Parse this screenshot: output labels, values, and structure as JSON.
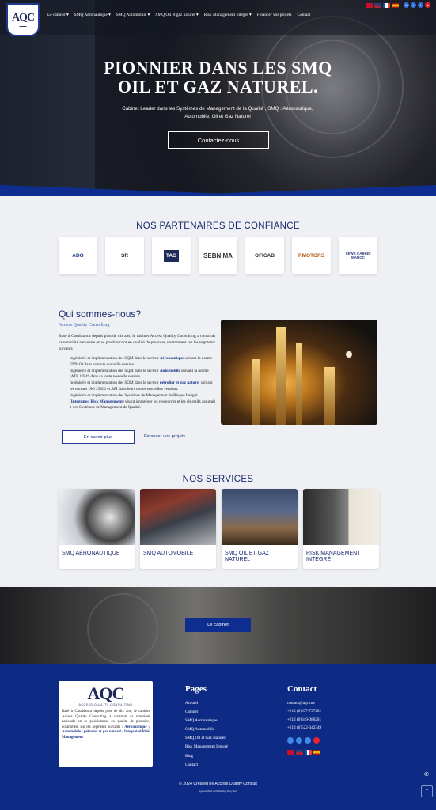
{
  "header": {
    "logo_text": "AQC",
    "nav": [
      {
        "label": "Le cabinet ▾"
      },
      {
        "label": "SMQ Aéronautique ▾"
      },
      {
        "label": "SMQ Automobile ▾"
      },
      {
        "label": "SMQ Oil et gaz naturel ▾"
      },
      {
        "label": "Risk Management Intégré ▾"
      },
      {
        "label": "Financer vos projets"
      },
      {
        "label": "Contact"
      }
    ],
    "flag_colors": [
      "#c8102e",
      "#3c3b6e",
      "#0055a4",
      "#aa151b"
    ],
    "social_icons": [
      "linkedin-icon",
      "facebook-icon",
      "twitter-icon",
      "youtube-icon"
    ]
  },
  "hero": {
    "title_line1": "PIONNIER DANS LES SMQ",
    "title_line2": "OIL ET GAZ NATUREL.",
    "subtitle": "Cabinet Leader dans les Systèmes de Management de la Qualité , SMQ : Aéronautique, Automobile, Oil et Gaz Naturel",
    "button": "Contactez-nous"
  },
  "partners": {
    "title": "NOS PARTENAIRES DE CONFIANCE",
    "logos": [
      "ADO",
      "SR",
      "TAG",
      "SEBN MA",
      "OFICAB",
      "RMOTORS",
      "SEWS CABIND MAROC"
    ]
  },
  "about": {
    "title": "Qui sommes-nous?",
    "subtitle": "Access Quality Consulting",
    "intro": "Basé à Casablanca depuis plus de dix ans, le cabinet Access Quality Consulting a construit sa notoriété nationale en se positionnant en qualité de pionnier, notamment sur les segments suivants :",
    "items": [
      {
        "pre": "Ingénierie et implémentation des SQM dans le secteur ",
        "hl": "Aéronautique",
        "post": " suivant la norme EN9100 dans sa toute nouvelle version."
      },
      {
        "pre": "Ingénierie et implémentation des SQM dans le secteur ",
        "hl": "Automobile",
        "post": " suivant la norme IATF 16949 dans sa toute nouvelle version."
      },
      {
        "pre": "Ingénierie et implémentation des SQM dans le secteur ",
        "hl": "pétrolier et gaz naturel",
        "post": " suivant les normes ISO 29001 et API dans leurs toutes nouvelles versions."
      },
      {
        "pre": "Ingénierie et implémentation des Systèmes de Management de Risque Intégré (",
        "hl": "Integrated Risk Management",
        "post": ") visant à protéger les ressources et les objectifs assignés à vos Systèmes de Management de Qualité."
      }
    ],
    "btn_more": "En savoir plus",
    "link_projects": "Financer vos projets"
  },
  "services": {
    "title": "NOS SERVICES",
    "items": [
      {
        "label": "SMQ AÉRONAUTIQUE"
      },
      {
        "label": "SMQ AUTOMOBILE"
      },
      {
        "label": "SMQ OIL ET GAZ NATUREL"
      },
      {
        "label": "RISK MANAGEMENT INTÉGRÉ"
      }
    ]
  },
  "band": {
    "button": "Le cabinet"
  },
  "footer": {
    "logo_text": "AQC",
    "logo_sub": "ACCESS QUALITY CONSULTING",
    "about_pre": "Basé à Casablanca depuis plus de dix ans, le cabinet Access Quality Consulting a construit sa notoriété nationale en se positionnant en qualité de pionnier, notamment sur les segments suivants : ",
    "about_hl": "Aéronautique ; Automobile ; pétrolier et gaz naturel ; Integrated Risk Management",
    "pages_title": "Pages",
    "pages": [
      "Accueil",
      "Cabinet",
      "SMQ Aéronautique",
      "SMQ Automobile",
      "SMQ Oil et Gaz Naturel",
      "Risk Management Intégré",
      "Blog",
      "Contact"
    ],
    "contact_title": "Contact",
    "contact": [
      "contact@aqc.ma",
      "+212 (0)677-737281",
      "+212 (0)649-388201",
      "+212 (0)522-342349"
    ],
    "copyright": "© 2024 Created By Access Quality Consult",
    "credit": "Agence Web et Marketing StoryTech"
  }
}
